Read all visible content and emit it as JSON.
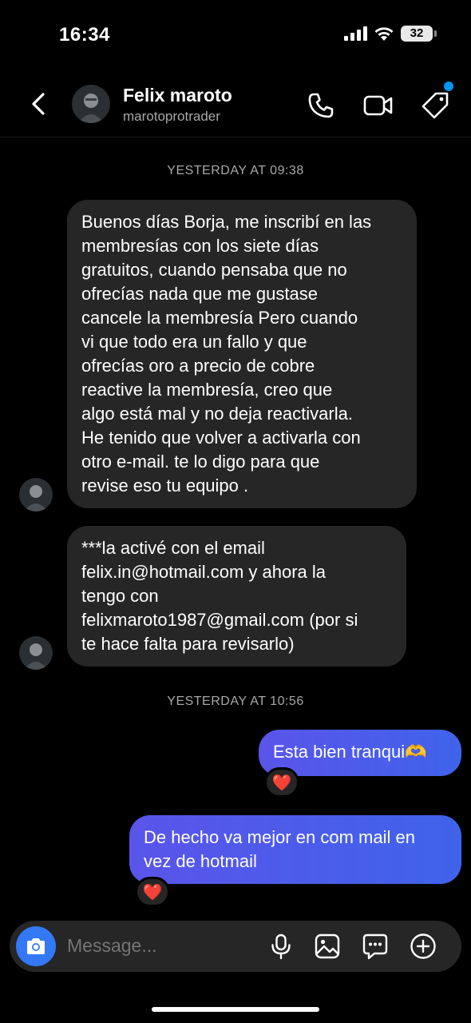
{
  "status_bar": {
    "time": "16:34",
    "battery": "32",
    "icons": [
      "cellular-signal-icon",
      "wifi-icon",
      "battery-icon"
    ]
  },
  "header": {
    "name": "Felix maroto",
    "username": "marotoprotrader",
    "icons": [
      "back-chevron-icon",
      "phone-icon",
      "video-camera-icon",
      "tag-icon"
    ],
    "notification_color": "#0095f6"
  },
  "conversation": {
    "timestamp_1": "YESTERDAY AT 09:38",
    "msg_1_lines": [
      "Buenos días Borja, me inscribí en las",
      "membresías con los siete días",
      "gratuitos, cuando pensaba que no",
      "ofrecías nada que me gustase",
      "cancele la membresía Pero cuando",
      "vi que todo era un fallo y que",
      "ofrecías oro a precio de cobre",
      "reactive la membresía, creo que",
      "algo está mal y no deja reactivarla.",
      "He tenido que volver a activarla con",
      "otro e-mail.  te lo digo para que",
      "revise eso tu equipo ."
    ],
    "msg_2_lines": [
      "***la activé con el email",
      "felix.in@hotmail.com y ahora la",
      "tengo con",
      "felixmaroto1987@gmail.com (por si",
      "te hace falta para revisarlo)"
    ],
    "timestamp_2": "YESTERDAY AT 10:56",
    "msg_3": "Esta bien tranqui🫶",
    "msg_3_reaction": "❤️",
    "msg_4_lines": [
      "De hecho va mejor en com mail en",
      "vez de hotmail"
    ],
    "msg_4_reaction": "❤️",
    "outgoing_color": "#4a5ced",
    "incoming_color": "#262626"
  },
  "composer": {
    "placeholder": "Message...",
    "icons": [
      "camera-icon",
      "microphone-icon",
      "gallery-icon",
      "sticker-icon",
      "plus-icon"
    ],
    "camera_color": "#3478f6"
  }
}
